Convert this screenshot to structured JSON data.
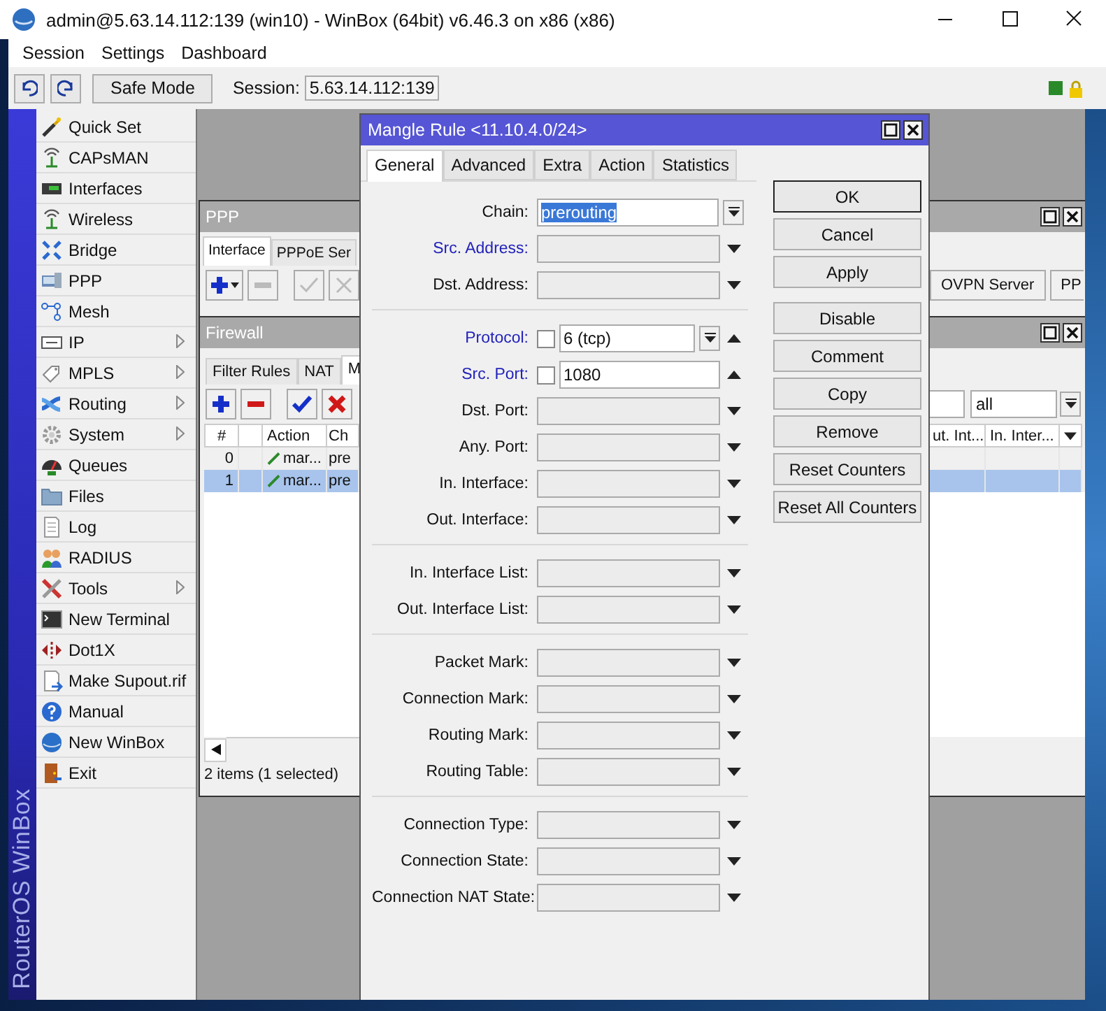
{
  "window": {
    "title": "admin@5.63.14.112:139 (win10) - WinBox (64bit) v6.46.3 on x86 (x86)"
  },
  "menu": [
    "Session",
    "Settings",
    "Dashboard"
  ],
  "toolbar": {
    "safe_mode": "Safe Mode",
    "session_label": "Session:",
    "session_value": "5.63.14.112:139"
  },
  "brand": "RouterOS WinBox",
  "sidebar": {
    "items": [
      {
        "label": "Quick Set",
        "submenu": false
      },
      {
        "label": "CAPsMAN",
        "submenu": false
      },
      {
        "label": "Interfaces",
        "submenu": false
      },
      {
        "label": "Wireless",
        "submenu": false
      },
      {
        "label": "Bridge",
        "submenu": false
      },
      {
        "label": "PPP",
        "submenu": false
      },
      {
        "label": "Mesh",
        "submenu": false
      },
      {
        "label": "IP",
        "submenu": true
      },
      {
        "label": "MPLS",
        "submenu": true
      },
      {
        "label": "Routing",
        "submenu": true
      },
      {
        "label": "System",
        "submenu": true
      },
      {
        "label": "Queues",
        "submenu": false
      },
      {
        "label": "Files",
        "submenu": false
      },
      {
        "label": "Log",
        "submenu": false
      },
      {
        "label": "RADIUS",
        "submenu": false
      },
      {
        "label": "Tools",
        "submenu": true
      },
      {
        "label": "New Terminal",
        "submenu": false
      },
      {
        "label": "Dot1X",
        "submenu": false
      },
      {
        "label": "Make Supout.rif",
        "submenu": false
      },
      {
        "label": "Manual",
        "submenu": false
      },
      {
        "label": "New WinBox",
        "submenu": false
      },
      {
        "label": "Exit",
        "submenu": false
      }
    ]
  },
  "ppp_window": {
    "title": "PPP",
    "tabs": [
      {
        "label": "Interface",
        "selected": true
      },
      {
        "label": "PPPoE Ser",
        "selected": false
      }
    ],
    "toolbar_buttons": [
      "OVPN Server",
      "PP"
    ]
  },
  "firewall_window": {
    "title": "Firewall",
    "tabs": [
      {
        "label": "Filter Rules",
        "selected": false
      },
      {
        "label": "NAT",
        "selected": false
      },
      {
        "label": "M",
        "selected": true
      }
    ],
    "filter": {
      "value": "all"
    },
    "columns_left": [
      "#",
      "Action",
      "Ch"
    ],
    "columns_right": [
      "ut. Int...",
      "In. Inter..."
    ],
    "rows": [
      {
        "number": "0",
        "action": "mar...",
        "chain": "pre",
        "selected": false
      },
      {
        "number": "1",
        "action": "mar...",
        "chain": "pre",
        "selected": true
      }
    ],
    "status": "2 items (1 selected)"
  },
  "dialog": {
    "title": "Mangle Rule <11.10.4.0/24>",
    "tabs": [
      {
        "label": "General",
        "selected": true
      },
      {
        "label": "Advanced",
        "selected": false
      },
      {
        "label": "Extra",
        "selected": false
      },
      {
        "label": "Action",
        "selected": false
      },
      {
        "label": "Statistics",
        "selected": false
      }
    ],
    "groups": [
      {
        "fields": [
          {
            "label": "Chain:",
            "kind": "select",
            "value": "prerouting",
            "value_selected": true,
            "highlighted": false
          },
          {
            "label": "Src. Address:",
            "kind": "text",
            "highlighted": true,
            "expanded": false
          },
          {
            "label": "Dst. Address:",
            "kind": "text",
            "highlighted": false,
            "expanded": false
          }
        ]
      },
      {
        "fields": [
          {
            "label": "Protocol:",
            "kind": "select",
            "value": "6 (tcp)",
            "highlighted": true,
            "negate": false,
            "expanded": true
          },
          {
            "label": "Src. Port:",
            "kind": "text",
            "value": "1080",
            "highlighted": true,
            "negate": false,
            "expanded": true
          },
          {
            "label": "Dst. Port:",
            "kind": "text",
            "highlighted": false,
            "expanded": false
          },
          {
            "label": "Any. Port:",
            "kind": "text",
            "highlighted": false,
            "expanded": false
          },
          {
            "label": "In. Interface:",
            "kind": "text",
            "highlighted": false,
            "expanded": false
          },
          {
            "label": "Out. Interface:",
            "kind": "text",
            "highlighted": false,
            "expanded": false
          }
        ]
      },
      {
        "fields": [
          {
            "label": "In. Interface List:",
            "kind": "text",
            "highlighted": false,
            "expanded": false
          },
          {
            "label": "Out. Interface List:",
            "kind": "text",
            "highlighted": false,
            "expanded": false
          }
        ]
      },
      {
        "fields": [
          {
            "label": "Packet Mark:",
            "kind": "text",
            "highlighted": false,
            "expanded": false
          },
          {
            "label": "Connection Mark:",
            "kind": "text",
            "highlighted": false,
            "expanded": false
          },
          {
            "label": "Routing Mark:",
            "kind": "text",
            "highlighted": false,
            "expanded": false
          },
          {
            "label": "Routing Table:",
            "kind": "text",
            "highlighted": false,
            "expanded": false
          }
        ]
      },
      {
        "fields": [
          {
            "label": "Connection Type:",
            "kind": "text",
            "highlighted": false,
            "expanded": false
          },
          {
            "label": "Connection State:",
            "kind": "text",
            "highlighted": false,
            "expanded": false
          },
          {
            "label": "Connection NAT State:",
            "kind": "text",
            "highlighted": false,
            "expanded": false
          }
        ]
      }
    ],
    "buttons": [
      {
        "label": "OK",
        "default": true
      },
      {
        "label": "Cancel",
        "default": false
      },
      {
        "label": "Apply",
        "default": false
      },
      {
        "label": "Disable",
        "default": false
      },
      {
        "label": "Comment",
        "default": false
      },
      {
        "label": "Copy",
        "default": false
      },
      {
        "label": "Remove",
        "default": false
      },
      {
        "label": "Reset Counters",
        "default": false
      },
      {
        "label": "Reset All Counters",
        "default": false
      }
    ]
  }
}
